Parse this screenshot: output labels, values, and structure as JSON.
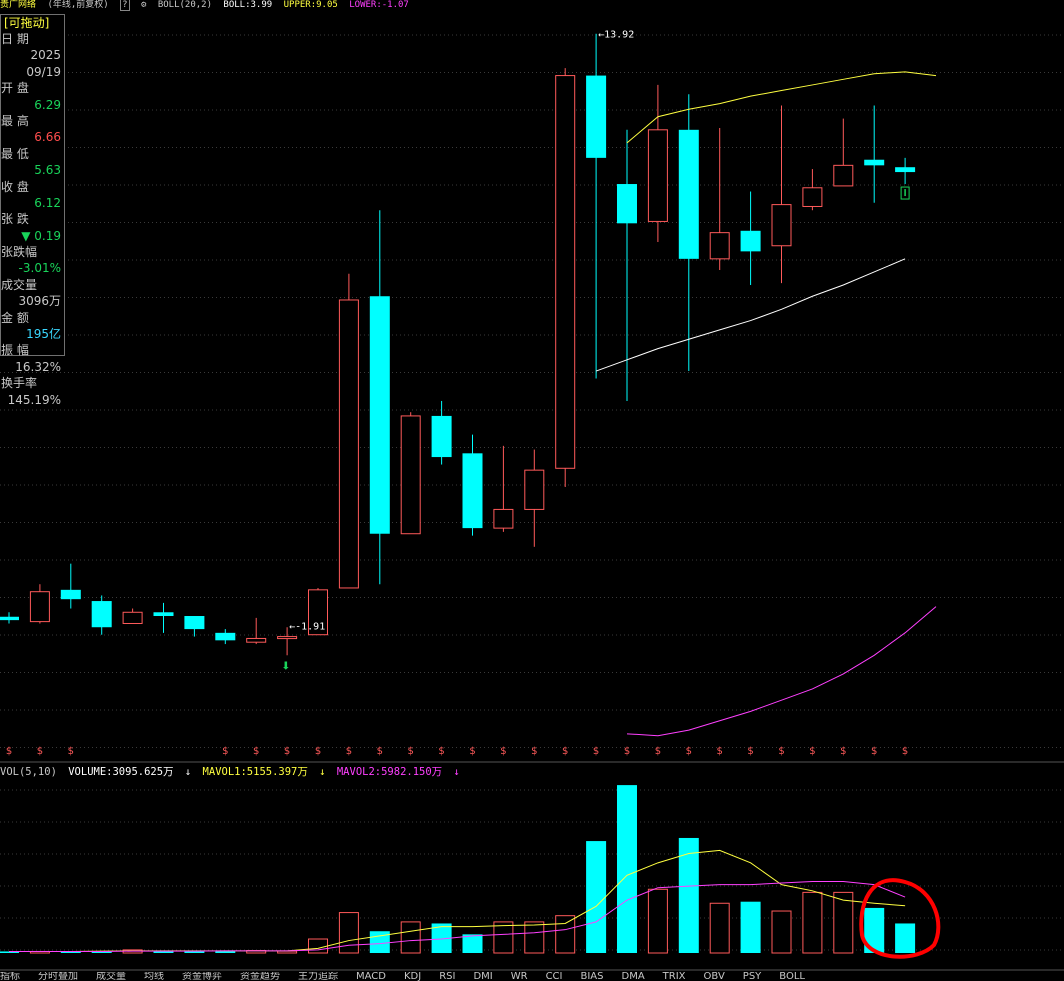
{
  "header": {
    "title": "贵广网络",
    "period": "(年线,前复权)",
    "indicator": "BOLL(20,2)",
    "boll": "BOLL:3.99",
    "upper": "UPPER:9.05",
    "lower": "LOWER:-1.07"
  },
  "info_panel": {
    "badge": "[可拖动]",
    "rows": [
      {
        "label": "日  期",
        "value": "",
        "color": "#c8c8c8"
      },
      {
        "label": "",
        "value": "2025",
        "color": "#c8c8c8"
      },
      {
        "label": "",
        "value": "09/19",
        "color": "#c8c8c8"
      },
      {
        "label": "开  盘",
        "value": "",
        "color": "#c8c8c8"
      },
      {
        "label": "",
        "value": "6.29",
        "color": "#19d45a"
      },
      {
        "label": "最  高",
        "value": "",
        "color": "#c8c8c8"
      },
      {
        "label": "",
        "value": "6.66",
        "color": "#ff4d4d"
      },
      {
        "label": "最  低",
        "value": "",
        "color": "#c8c8c8"
      },
      {
        "label": "",
        "value": "5.63",
        "color": "#19d45a"
      },
      {
        "label": "收  盘",
        "value": "",
        "color": "#c8c8c8"
      },
      {
        "label": "",
        "value": "6.12",
        "color": "#19d45a"
      },
      {
        "label": "张  跌",
        "value": "",
        "color": "#c8c8c8"
      },
      {
        "label": "",
        "value": "▼ 0.19",
        "color": "#19d45a"
      },
      {
        "label": "张跌幅",
        "value": "",
        "color": "#c8c8c8"
      },
      {
        "label": "",
        "value": "-3.01%",
        "color": "#19d45a"
      },
      {
        "label": "成交量",
        "value": "",
        "color": "#c8c8c8"
      },
      {
        "label": "",
        "value": "3096万",
        "color": "#c8c8c8"
      },
      {
        "label": "金  额",
        "value": "",
        "color": "#c8c8c8"
      },
      {
        "label": "",
        "value": "195亿",
        "color": "#3ad8ff"
      },
      {
        "label": "振  幅",
        "value": "",
        "color": "#c8c8c8"
      },
      {
        "label": "",
        "value": "16.32%",
        "color": "#c8c8c8"
      },
      {
        "label": "换手率",
        "value": "",
        "color": "#c8c8c8"
      },
      {
        "label": "",
        "value": "145.19%",
        "color": "#c8c8c8"
      }
    ]
  },
  "volume_header": {
    "indicator": "VOL(5,10)",
    "volume": "VOLUME:3095.625万",
    "mavol1": "MAVOL1:5155.397万",
    "mavol2": "MAVOL2:5982.150万"
  },
  "bottom_tabs": [
    "指标",
    "分时叠加",
    "成交量",
    "均线",
    "资金博弈",
    "资金趋势",
    "主力追踪",
    "MACD",
    "KDJ",
    "RSI",
    "DMI",
    "WR",
    "CCI",
    "BIAS",
    "DMA",
    "TRIX",
    "OBV",
    "PSY",
    "BOLL"
  ],
  "chart_data": {
    "type": "candlestick",
    "period": "year",
    "ylim": [
      -5.5,
      14.5
    ],
    "colors": {
      "up": "#ff5a5a",
      "down": "#00ffff",
      "boll_mid": "#ffffff",
      "boll_upper": "#ffff40",
      "boll_lower": "#ff40ff",
      "mavol1": "#ffff40",
      "mavol2": "#ff40ff"
    },
    "annotations": [
      {
        "text": "13.92",
        "index": 19,
        "value": 13.92
      },
      {
        "text": "-1.91",
        "index": 9,
        "value": -1.91
      }
    ],
    "candles": [
      {
        "open": -1.67,
        "high": -1.55,
        "low": -1.85,
        "close": -1.76
      },
      {
        "open": -1.8,
        "high": -0.8,
        "low": -1.85,
        "close": -1.0
      },
      {
        "open": -0.95,
        "high": -0.25,
        "low": -1.45,
        "close": -1.2
      },
      {
        "open": -1.25,
        "high": -1.1,
        "low": -2.15,
        "close": -1.95
      },
      {
        "open": -1.85,
        "high": -1.45,
        "low": -1.85,
        "close": -1.55
      },
      {
        "open": -1.55,
        "high": -1.3,
        "low": -2.1,
        "close": -1.65
      },
      {
        "open": -1.65,
        "high": -1.65,
        "low": -2.2,
        "close": -2.0
      },
      {
        "open": -2.1,
        "high": -2.0,
        "low": -2.4,
        "close": -2.3
      },
      {
        "open": -2.35,
        "high": -1.7,
        "low": -2.4,
        "close": -2.25
      },
      {
        "open": -2.2,
        "high": -1.95,
        "low": -2.7,
        "close": -2.2
      },
      {
        "open": -2.15,
        "high": -0.9,
        "low": -2.15,
        "close": -0.95
      },
      {
        "open": -0.9,
        "high": 7.5,
        "low": -0.9,
        "close": 6.8
      },
      {
        "open": 6.9,
        "high": 9.2,
        "low": -0.8,
        "close": 0.55
      },
      {
        "open": 0.55,
        "high": 3.8,
        "low": 0.55,
        "close": 3.7
      },
      {
        "open": 3.7,
        "high": 4.1,
        "low": 2.4,
        "close": 2.6
      },
      {
        "open": 2.7,
        "high": 3.2,
        "low": 0.5,
        "close": 0.7
      },
      {
        "open": 0.7,
        "high": 2.9,
        "low": 0.6,
        "close": 1.2
      },
      {
        "open": 1.2,
        "high": 2.8,
        "low": 0.2,
        "close": 2.25
      },
      {
        "open": 2.3,
        "high": 13.0,
        "low": 1.8,
        "close": 12.8
      },
      {
        "open": 12.8,
        "high": 13.92,
        "low": 4.7,
        "close": 10.6
      },
      {
        "open": 9.9,
        "high": 11.35,
        "low": 4.1,
        "close": 8.85
      },
      {
        "open": 8.9,
        "high": 12.55,
        "low": 8.35,
        "close": 11.35
      },
      {
        "open": 11.35,
        "high": 12.3,
        "low": 4.9,
        "close": 7.9
      },
      {
        "open": 7.9,
        "high": 11.4,
        "low": 7.6,
        "close": 8.6
      },
      {
        "open": 8.65,
        "high": 9.7,
        "low": 7.2,
        "close": 8.1
      },
      {
        "open": 8.25,
        "high": 12.0,
        "low": 7.25,
        "close": 9.35
      },
      {
        "open": 9.3,
        "high": 10.3,
        "low": 9.2,
        "close": 9.8
      },
      {
        "open": 9.85,
        "high": 11.65,
        "low": 9.85,
        "close": 10.4
      },
      {
        "open": 10.55,
        "high": 12.0,
        "low": 9.4,
        "close": 10.4
      },
      {
        "open": 10.35,
        "high": 10.6,
        "low": 9.9,
        "close": 10.22
      }
    ],
    "boll_mid_start": 19,
    "boll_mid": [
      4.9,
      5.2,
      5.5,
      5.75,
      6.0,
      6.25,
      6.55,
      6.9,
      7.2,
      7.55,
      7.9
    ],
    "boll_upper_start": 20,
    "boll_upper": [
      11.0,
      11.7,
      11.9,
      12.05,
      12.25,
      12.4,
      12.55,
      12.7,
      12.85,
      12.9,
      12.8
    ],
    "boll_lower_start": 20,
    "boll_lower": [
      -4.8,
      -4.85,
      -4.7,
      -4.45,
      -4.2,
      -3.9,
      -3.6,
      -3.2,
      -2.7,
      -2.1,
      -1.4
    ],
    "signal_marks": [
      0,
      1,
      2,
      7,
      8,
      9,
      10,
      11,
      12,
      13,
      14,
      15,
      16,
      17,
      18,
      19,
      20,
      21,
      22,
      23,
      24,
      25,
      26,
      27,
      28,
      29
    ],
    "volume": {
      "ylim": [
        0,
        5.5
      ],
      "unit": "亿",
      "values": [
        0.05,
        0.05,
        0.06,
        0.06,
        0.1,
        0.08,
        0.06,
        0.06,
        0.08,
        0.06,
        0.45,
        1.3,
        0.7,
        1.0,
        0.95,
        0.6,
        1.0,
        1.0,
        1.2,
        3.6,
        5.4,
        2.05,
        3.7,
        1.6,
        1.65,
        1.35,
        1.95,
        1.95,
        1.45,
        0.95
      ],
      "mavol1": [
        0.05,
        0.05,
        0.05,
        0.06,
        0.07,
        0.07,
        0.07,
        0.07,
        0.07,
        0.07,
        0.15,
        0.4,
        0.55,
        0.7,
        0.85,
        0.85,
        0.88,
        0.9,
        0.95,
        1.5,
        2.5,
        2.9,
        3.2,
        3.3,
        2.9,
        2.2,
        2.0,
        1.7,
        1.6,
        1.52
      ],
      "mavol2": [
        0.05,
        0.05,
        0.05,
        0.05,
        0.06,
        0.06,
        0.06,
        0.07,
        0.07,
        0.07,
        0.1,
        0.25,
        0.3,
        0.4,
        0.45,
        0.55,
        0.6,
        0.65,
        0.75,
        1.0,
        1.7,
        2.1,
        2.15,
        2.2,
        2.2,
        2.25,
        2.3,
        2.3,
        2.2,
        1.8
      ]
    }
  }
}
